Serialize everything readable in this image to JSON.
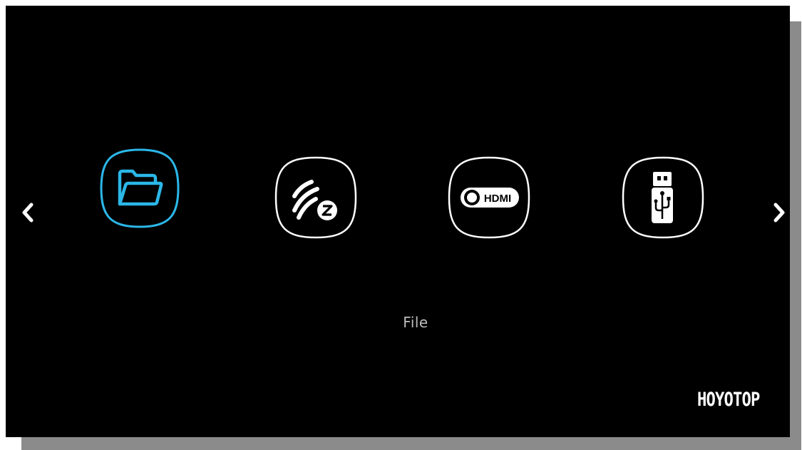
{
  "nav": {
    "prev_icon": "chevron-left-icon",
    "next_icon": "chevron-right-icon"
  },
  "tiles": [
    {
      "id": "file",
      "icon": "folder-icon",
      "selected": true
    },
    {
      "id": "ezcast",
      "icon": "ezcast-icon",
      "selected": false
    },
    {
      "id": "hdmi",
      "icon": "hdmi-icon",
      "selected": false,
      "icon_text": "HDMI"
    },
    {
      "id": "usb",
      "icon": "usb-drive-icon",
      "selected": false
    }
  ],
  "selected_label": "File",
  "brand": {
    "name": "HOYOTOP"
  },
  "colors": {
    "background": "#000000",
    "accent": "#2bb7e8",
    "tile_border": "#ffffff",
    "label": "#bdbdbd"
  }
}
